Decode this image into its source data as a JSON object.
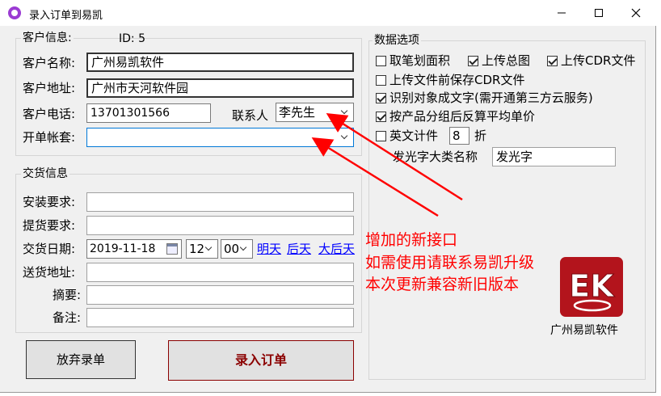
{
  "window": {
    "title": "录入订单到易凯"
  },
  "customer": {
    "group_title": "客户信息:",
    "id_text": "ID: 5",
    "name_label": "客户名称:",
    "name_value": "广州易凯软件",
    "address_label": "客户地址:",
    "address_value": "广州市天河软件园",
    "phone_label": "客户电话:",
    "phone_value": "13701301566",
    "contact_label": "联系人",
    "contact_value": "李先生",
    "account_label": "开单帐套:",
    "account_value": ""
  },
  "delivery": {
    "group_title": "交货信息",
    "install_label": "安装要求:",
    "install_value": "",
    "pickup_label": "提货要求:",
    "pickup_value": "",
    "date_label": "交货日期:",
    "date_value": "2019-11-18",
    "hour_value": "12",
    "minute_value": "00",
    "link_tomorrow": "明天",
    "link_day_after": "后天",
    "link_three_days": "大后天",
    "ship_address_label": "送货地址:",
    "ship_address_value": "",
    "summary_label": "摘要:",
    "summary_value": "",
    "note_label": "备注:",
    "note_value": ""
  },
  "options": {
    "group_title": "数据选项",
    "pen_area": {
      "label": "取笔划面积",
      "checked": false
    },
    "upload_overview": {
      "label": "上传总图",
      "checked": true
    },
    "upload_cdr": {
      "label": "上传CDR文件",
      "checked": true
    },
    "save_before_upload": {
      "label": "上传文件前保存CDR文件",
      "checked": false
    },
    "recognize_text": {
      "label": "识别对象成文字(需开通第三方云服务)",
      "checked": true
    },
    "group_average": {
      "label": "按产品分组后反算平均单价",
      "checked": true
    },
    "english_count": {
      "label": "英文计件",
      "checked": false
    },
    "english_count_value": "8",
    "english_count_suffix": "折",
    "luminous_label": "发光字大类名称",
    "luminous_value": "发光字"
  },
  "buttons": {
    "cancel": "放弃录单",
    "submit": "录入订单"
  },
  "annotation": {
    "line1": "增加的新接口",
    "line2": "如需使用请联系易凯升级",
    "line3": "本次更新兼容新旧版本"
  },
  "logo": {
    "letters": "EK",
    "company": "广州易凯软件"
  },
  "colors": {
    "annotation": "#ff0000",
    "link": "#0000ff",
    "submit_text": "#8b0000",
    "logo_red": "#b3141c"
  }
}
